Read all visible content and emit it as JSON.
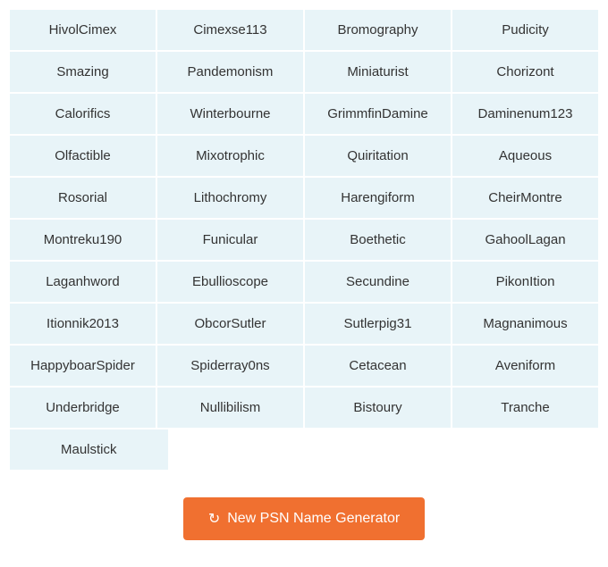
{
  "grid": {
    "rows": [
      [
        "HivolCimex",
        "Cimexse113",
        "Bromography",
        "Pudicity"
      ],
      [
        "Smazing",
        "Pandemonism",
        "Miniaturist",
        "Chorizont"
      ],
      [
        "Calorifics",
        "Winterbourne",
        "GrimmfinDamine",
        "Daminenum123"
      ],
      [
        "Olfactible",
        "Mixotrophic",
        "Quiritation",
        "Aqueous"
      ],
      [
        "Rosorial",
        "Lithochromy",
        "Harengiform",
        "CheirMontre"
      ],
      [
        "Montreku190",
        "Funicular",
        "Boethetic",
        "GahoolLagan"
      ],
      [
        "Laganhword",
        "Ebullioscope",
        "Secundine",
        "PikonItion"
      ],
      [
        "Itionnik2013",
        "ObcorSutler",
        "Sutlerpig31",
        "Magnanimous"
      ],
      [
        "HappyboarSpider",
        "Spiderray0ns",
        "Cetacean",
        "Aveniform"
      ],
      [
        "Underbridge",
        "Nullibilism",
        "Bistoury",
        "Tranche"
      ],
      [
        "Maulstick",
        "",
        "",
        ""
      ]
    ]
  },
  "button": {
    "label": "New PSN Name Generator",
    "icon": "🔄"
  }
}
